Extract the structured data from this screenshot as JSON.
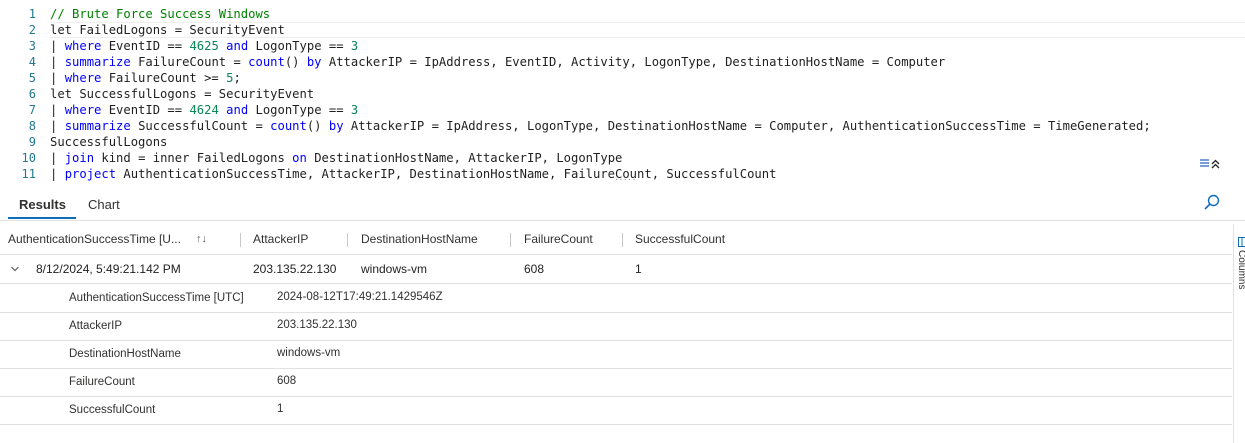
{
  "editor": {
    "line_numbers": [
      "1",
      "2",
      "3",
      "4",
      "5",
      "6",
      "7",
      "8",
      "9",
      "10",
      "11"
    ],
    "lines": [
      [
        {
          "t": "// Brute Force Success Windows",
          "c": "cmt"
        }
      ],
      [
        {
          "t": "let FailedLogons = SecurityEvent",
          "c": ""
        }
      ],
      [
        {
          "t": "| ",
          "c": "pipe"
        },
        {
          "t": "where",
          "c": "kw"
        },
        {
          "t": " EventID == ",
          "c": ""
        },
        {
          "t": "4625",
          "c": "num"
        },
        {
          "t": " ",
          "c": ""
        },
        {
          "t": "and",
          "c": "kw"
        },
        {
          "t": " LogonType == ",
          "c": ""
        },
        {
          "t": "3",
          "c": "num"
        }
      ],
      [
        {
          "t": "| ",
          "c": "pipe"
        },
        {
          "t": "summarize",
          "c": "kw"
        },
        {
          "t": " FailureCount = ",
          "c": ""
        },
        {
          "t": "count",
          "c": "kw"
        },
        {
          "t": "() ",
          "c": ""
        },
        {
          "t": "by",
          "c": "kw"
        },
        {
          "t": " AttackerIP = IpAddress, EventID, Activity, LogonType, DestinationHostName = Computer",
          "c": ""
        }
      ],
      [
        {
          "t": "| ",
          "c": "pipe"
        },
        {
          "t": "where",
          "c": "kw"
        },
        {
          "t": " FailureCount >= ",
          "c": ""
        },
        {
          "t": "5",
          "c": "num"
        },
        {
          "t": ";",
          "c": ""
        }
      ],
      [
        {
          "t": "let SuccessfulLogons = SecurityEvent",
          "c": ""
        }
      ],
      [
        {
          "t": "| ",
          "c": "pipe"
        },
        {
          "t": "where",
          "c": "kw"
        },
        {
          "t": " EventID == ",
          "c": ""
        },
        {
          "t": "4624",
          "c": "num"
        },
        {
          "t": " ",
          "c": ""
        },
        {
          "t": "and",
          "c": "kw"
        },
        {
          "t": " LogonType == ",
          "c": ""
        },
        {
          "t": "3",
          "c": "num"
        }
      ],
      [
        {
          "t": "| ",
          "c": "pipe"
        },
        {
          "t": "summarize",
          "c": "kw"
        },
        {
          "t": " SuccessfulCount = ",
          "c": ""
        },
        {
          "t": "count",
          "c": "kw"
        },
        {
          "t": "() ",
          "c": ""
        },
        {
          "t": "by",
          "c": "kw"
        },
        {
          "t": " AttackerIP = IpAddress, LogonType, DestinationHostName = Computer, AuthenticationSuccessTime = TimeGenerated;",
          "c": ""
        }
      ],
      [
        {
          "t": "SuccessfulLogons",
          "c": ""
        }
      ],
      [
        {
          "t": "| ",
          "c": "pipe"
        },
        {
          "t": "join",
          "c": "kw"
        },
        {
          "t": " kind = inner FailedLogons ",
          "c": ""
        },
        {
          "t": "on",
          "c": "kw"
        },
        {
          "t": " DestinationHostName, AttackerIP, LogonType",
          "c": ""
        }
      ],
      [
        {
          "t": "| ",
          "c": "pipe"
        },
        {
          "t": "project",
          "c": "kw"
        },
        {
          "t": " AuthenticationSuccessTime, AttackerIP, DestinationHostName, FailureCount, SuccessfulCount",
          "c": ""
        }
      ]
    ],
    "collapse_icon": "collapse-up-icon"
  },
  "tabs": {
    "results": "Results",
    "chart": "Chart"
  },
  "table": {
    "headers": {
      "auth_time": "AuthenticationSuccessTime [U...",
      "attacker_ip": "AttackerIP",
      "dest_host": "DestinationHostName",
      "failure_count": "FailureCount",
      "successful_count": "SuccessfulCount"
    },
    "row": {
      "auth_time": "8/12/2024, 5:49:21.142 PM",
      "attacker_ip": "203.135.22.130",
      "dest_host": "windows-vm",
      "failure_count": "608",
      "successful_count": "1"
    },
    "details": [
      {
        "label": "AuthenticationSuccessTime [UTC]",
        "value": "2024-08-12T17:49:21.1429546Z"
      },
      {
        "label": "AttackerIP",
        "value": "203.135.22.130"
      },
      {
        "label": "DestinationHostName",
        "value": "windows-vm"
      },
      {
        "label": "FailureCount",
        "value": "608"
      },
      {
        "label": "SuccessfulCount",
        "value": "1"
      }
    ]
  },
  "right_rail": {
    "columns_label": "Columns"
  },
  "icons": {
    "search": "search-icon",
    "sort": "sort-icon",
    "expand": "chevron-down-icon",
    "columns": "columns-icon"
  },
  "colors": {
    "keyword": "#0000ff",
    "number": "#098658",
    "comment": "#008000",
    "line_number": "#237893",
    "accent": "#0f6cbd"
  }
}
